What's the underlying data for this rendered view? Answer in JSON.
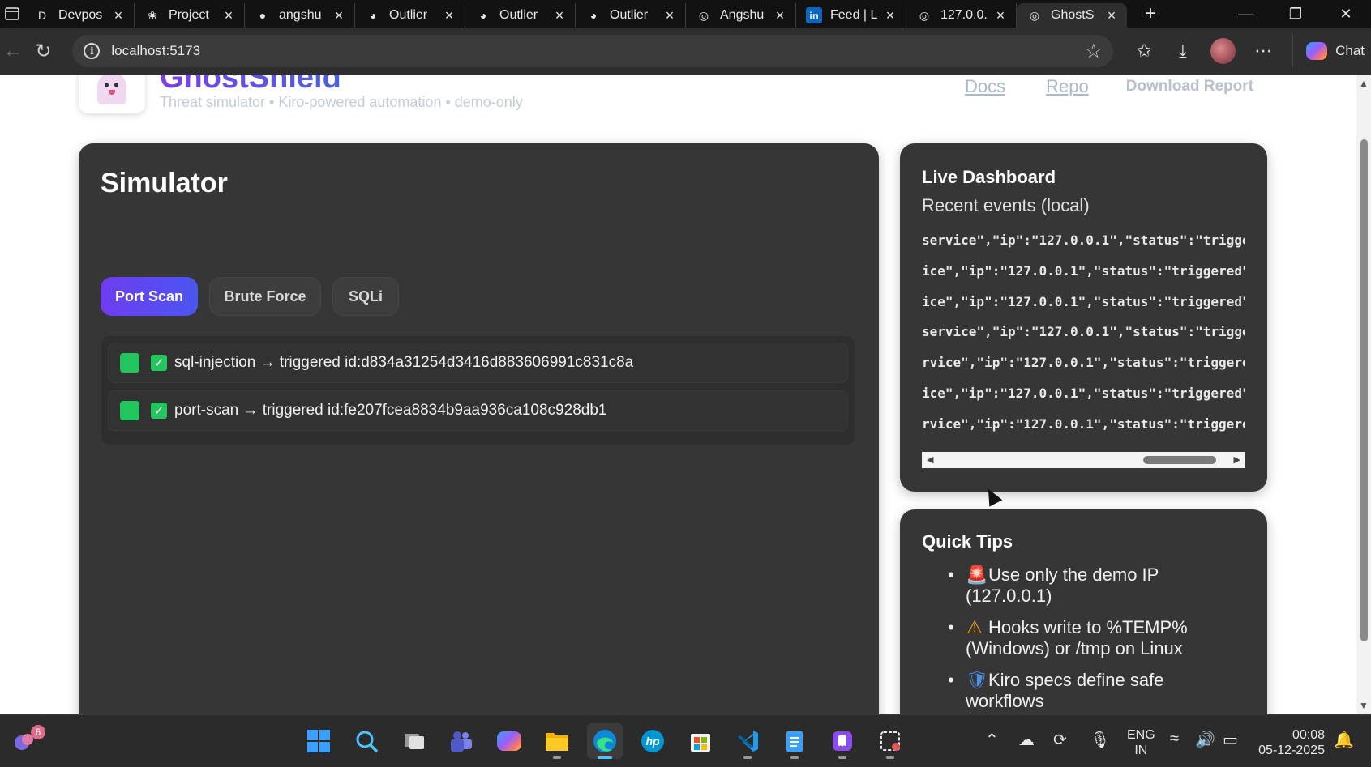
{
  "browser": {
    "tabs": [
      {
        "title": "Devpos",
        "icon": "devpost-icon",
        "glyph": "D",
        "active": false
      },
      {
        "title": "Project",
        "icon": "openai-icon",
        "glyph": "❀",
        "active": false
      },
      {
        "title": "angshu",
        "icon": "github-icon",
        "glyph": "●",
        "active": false
      },
      {
        "title": "Outlier",
        "icon": "outlier-icon",
        "glyph": "◕",
        "active": false
      },
      {
        "title": "Outlier",
        "icon": "outlier-icon",
        "glyph": "◕",
        "active": false
      },
      {
        "title": "Outlier",
        "icon": "outlier-icon",
        "glyph": "◕",
        "active": false
      },
      {
        "title": "Angshu",
        "icon": "globe-icon",
        "glyph": "◎",
        "active": false
      },
      {
        "title": "Feed | L",
        "icon": "linkedin-icon",
        "glyph": "in",
        "active": false
      },
      {
        "title": "127.0.0.",
        "icon": "globe-icon",
        "glyph": "◎",
        "active": false
      },
      {
        "title": "GhostS",
        "icon": "globe-icon",
        "glyph": "◎",
        "active": true
      }
    ],
    "new_tab": "+",
    "url": "localhost:5173",
    "chat_label": "Chat"
  },
  "page": {
    "brand": {
      "name": "GhostShield",
      "tagline": "Threat simulator • Kiro-powered automation • demo-only"
    },
    "nav": {
      "docs": "Docs",
      "repo": "Repo",
      "download": "Download Report"
    },
    "simulator": {
      "title": "Simulator",
      "tabs": [
        "Port Scan",
        "Brute Force",
        "SQLi"
      ],
      "active_tab": "Port Scan",
      "events": [
        "sql-injection → triggered id:d834a31254d3416d883606991c831c8a",
        "port-scan → triggered id:fe207fcea8834b9aa936ca108c928db1"
      ]
    },
    "dashboard": {
      "title": "Live Dashboard",
      "subtitle": "Recent events (local)",
      "log_lines": [
        "service\",\"ip\":\"127.0.0.1\",\"status\":\"trigge",
        "ice\",\"ip\":\"127.0.0.1\",\"status\":\"triggered\"",
        "ice\",\"ip\":\"127.0.0.1\",\"status\":\"triggered\"",
        "service\",\"ip\":\"127.0.0.1\",\"status\":\"trigge",
        "rvice\",\"ip\":\"127.0.0.1\",\"status\":\"triggere",
        "ice\",\"ip\":\"127.0.0.1\",\"status\":\"triggered\"",
        "rvice\",\"ip\":\"127.0.0.1\",\"status\":\"triggere"
      ]
    },
    "tips": {
      "title": "Quick Tips",
      "items": [
        {
          "icon": "siren-icon",
          "glyph": "🚨",
          "text": "Use only the demo IP (127.0.0.1)"
        },
        {
          "icon": "warning-icon",
          "glyph": "⚠",
          "text": "Hooks write to %TEMP% (Windows) or /tmp on Linux"
        },
        {
          "icon": "shield-icon",
          "glyph": "🛡",
          "text": "Kiro specs define safe workflows"
        }
      ]
    }
  },
  "taskbar": {
    "notification_count": "6",
    "language": "ENG",
    "region": "IN",
    "time": "00:08",
    "date": "05-12-2025"
  },
  "colors": {
    "accent_gradient_start": "#6f3cf0",
    "accent_gradient_end": "#4a56f0",
    "success": "#22c55e",
    "panel": "#363636"
  }
}
